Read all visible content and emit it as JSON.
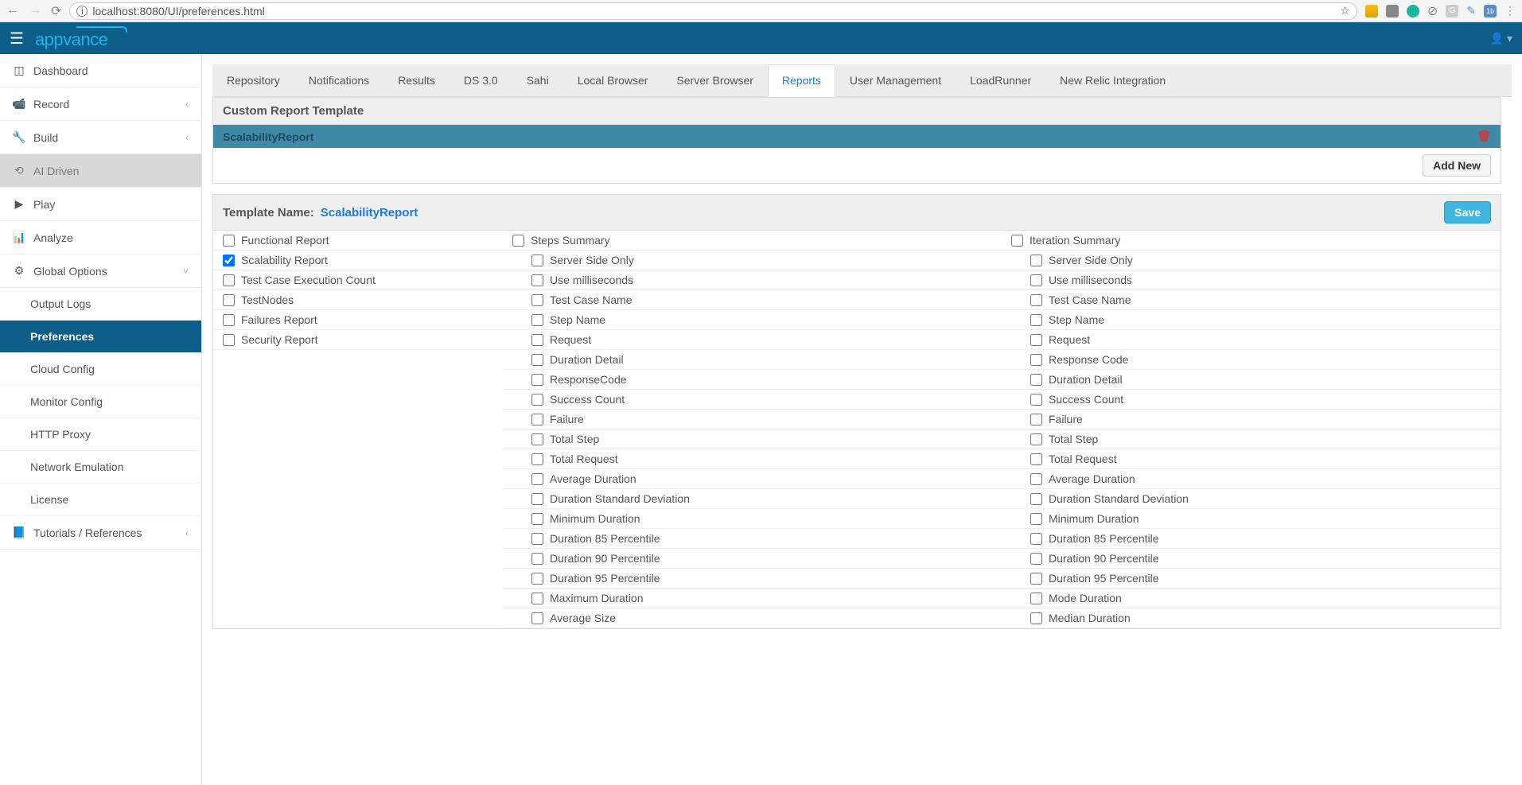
{
  "browser": {
    "url": "localhost:8080/UI/preferences.html"
  },
  "header": {
    "logo": "appvance"
  },
  "sidebar": {
    "items": [
      {
        "icon": "dashboard",
        "label": "Dashboard",
        "chev": false
      },
      {
        "icon": "camera",
        "label": "Record",
        "chev": true
      },
      {
        "icon": "wrench",
        "label": "Build",
        "chev": true
      },
      {
        "icon": "ai",
        "label": "AI Driven",
        "chev": false,
        "activeParent": true
      },
      {
        "icon": "play",
        "label": "Play",
        "chev": false
      },
      {
        "icon": "chart",
        "label": "Analyze",
        "chev": false
      },
      {
        "icon": "gears",
        "label": "Global Options",
        "chev": true,
        "expanded": true
      }
    ],
    "subitems": [
      {
        "label": "Output Logs"
      },
      {
        "label": "Preferences",
        "active": true
      },
      {
        "label": "Cloud Config"
      },
      {
        "label": "Monitor Config"
      },
      {
        "label": "HTTP Proxy"
      },
      {
        "label": "Network Emulation"
      },
      {
        "label": "License"
      }
    ],
    "tutorials": {
      "icon": "book",
      "label": "Tutorials / References",
      "chev": true
    }
  },
  "tabs": [
    {
      "label": "Repository"
    },
    {
      "label": "Notifications"
    },
    {
      "label": "Results"
    },
    {
      "label": "DS 3.0"
    },
    {
      "label": "Sahi"
    },
    {
      "label": "Local Browser"
    },
    {
      "label": "Server Browser"
    },
    {
      "label": "Reports",
      "active": true
    },
    {
      "label": "User Management"
    },
    {
      "label": "LoadRunner"
    },
    {
      "label": "New Relic Integration"
    }
  ],
  "panel": {
    "title": "Custom Report Template",
    "template_item": "ScalabilityReport",
    "add_new": "Add New",
    "template_name_label": "Template Name:",
    "template_name_value": "ScalabilityReport",
    "save": "Save"
  },
  "columns": {
    "col1": [
      {
        "label": "Functional Report",
        "checked": false,
        "indent": false
      },
      {
        "label": "Scalability Report",
        "checked": true,
        "indent": false
      },
      {
        "label": "Test Case Execution Count",
        "checked": false,
        "indent": false
      },
      {
        "label": "TestNodes",
        "checked": false,
        "indent": false
      },
      {
        "label": "Failures Report",
        "checked": false,
        "indent": false
      },
      {
        "label": "Security Report",
        "checked": false,
        "indent": false
      }
    ],
    "col2": [
      {
        "label": "Steps Summary",
        "checked": false,
        "indent": false
      },
      {
        "label": "Server Side Only",
        "checked": false,
        "indent": true
      },
      {
        "label": "Use milliseconds",
        "checked": false,
        "indent": true
      },
      {
        "label": "Test Case Name",
        "checked": false,
        "indent": true
      },
      {
        "label": "Step Name",
        "checked": false,
        "indent": true
      },
      {
        "label": "Request",
        "checked": false,
        "indent": true
      },
      {
        "label": "Duration Detail",
        "checked": false,
        "indent": true
      },
      {
        "label": "ResponseCode",
        "checked": false,
        "indent": true
      },
      {
        "label": "Success Count",
        "checked": false,
        "indent": true
      },
      {
        "label": "Failure",
        "checked": false,
        "indent": true
      },
      {
        "label": "Total Step",
        "checked": false,
        "indent": true
      },
      {
        "label": "Total Request",
        "checked": false,
        "indent": true
      },
      {
        "label": "Average Duration",
        "checked": false,
        "indent": true
      },
      {
        "label": "Duration Standard Deviation",
        "checked": false,
        "indent": true
      },
      {
        "label": "Minimum Duration",
        "checked": false,
        "indent": true
      },
      {
        "label": "Duration 85 Percentile",
        "checked": false,
        "indent": true
      },
      {
        "label": "Duration 90 Percentile",
        "checked": false,
        "indent": true
      },
      {
        "label": "Duration 95 Percentile",
        "checked": false,
        "indent": true
      },
      {
        "label": "Maximum Duration",
        "checked": false,
        "indent": true
      },
      {
        "label": "Average Size",
        "checked": false,
        "indent": true
      }
    ],
    "col3": [
      {
        "label": "Iteration Summary",
        "checked": false,
        "indent": false
      },
      {
        "label": "Server Side Only",
        "checked": false,
        "indent": true
      },
      {
        "label": "Use milliseconds",
        "checked": false,
        "indent": true
      },
      {
        "label": "Test Case Name",
        "checked": false,
        "indent": true
      },
      {
        "label": "Step Name",
        "checked": false,
        "indent": true
      },
      {
        "label": "Request",
        "checked": false,
        "indent": true
      },
      {
        "label": "Response Code",
        "checked": false,
        "indent": true
      },
      {
        "label": "Duration Detail",
        "checked": false,
        "indent": true
      },
      {
        "label": "Success Count",
        "checked": false,
        "indent": true
      },
      {
        "label": "Failure",
        "checked": false,
        "indent": true
      },
      {
        "label": "Total Step",
        "checked": false,
        "indent": true
      },
      {
        "label": "Total Request",
        "checked": false,
        "indent": true
      },
      {
        "label": "Average Duration",
        "checked": false,
        "indent": true
      },
      {
        "label": "Duration Standard Deviation",
        "checked": false,
        "indent": true
      },
      {
        "label": "Minimum Duration",
        "checked": false,
        "indent": true
      },
      {
        "label": "Duration 85 Percentile",
        "checked": false,
        "indent": true
      },
      {
        "label": "Duration 90 Percentile",
        "checked": false,
        "indent": true
      },
      {
        "label": "Duration 95 Percentile",
        "checked": false,
        "indent": true
      },
      {
        "label": "Mode Duration",
        "checked": false,
        "indent": true
      },
      {
        "label": "Median Duration",
        "checked": false,
        "indent": true
      }
    ]
  }
}
